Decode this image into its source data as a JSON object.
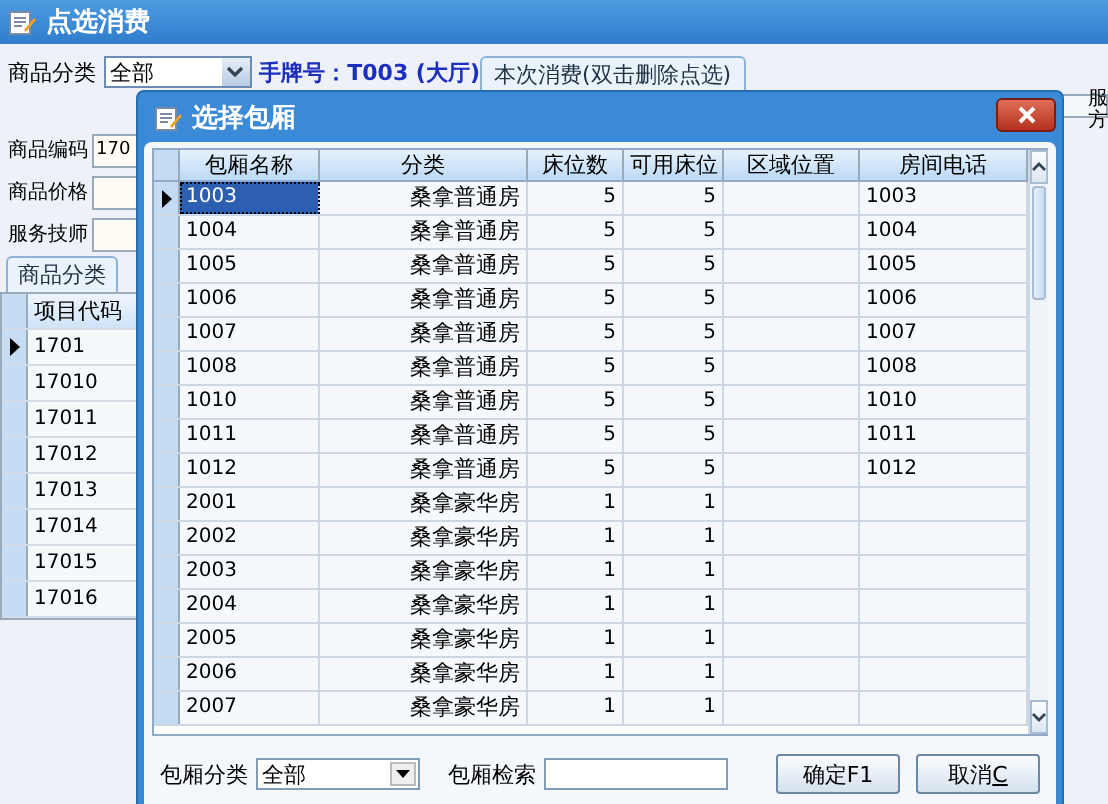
{
  "window": {
    "title": "点选消费"
  },
  "filters": {
    "category_label": "商品分类",
    "category_value": "全部",
    "tag_number": "手牌号：T003 (大厅)"
  },
  "consumption_tab": {
    "label": "本次消费(双击删除点选)",
    "selected": true
  },
  "consumption_grid_partial_header": [
    "服",
    "方"
  ],
  "fields": [
    {
      "label": "商品编码",
      "value": "170"
    },
    {
      "label": "商品价格"
    },
    {
      "label": "服务技师"
    }
  ],
  "item_tabs": [
    {
      "label": "商品分类",
      "selected": true
    }
  ],
  "items_table": {
    "columns": [
      "项目代码"
    ],
    "rows": [
      {
        "code": "1701",
        "selected": true
      },
      {
        "code": "17010",
        "selected": false
      },
      {
        "code": "17011",
        "selected": false
      },
      {
        "code": "17012",
        "selected": false
      },
      {
        "code": "17013",
        "selected": false
      },
      {
        "code": "17014",
        "selected": false
      },
      {
        "code": "17015",
        "selected": false
      },
      {
        "code": "17016",
        "selected": false
      }
    ]
  },
  "dialog": {
    "title": "选择包厢",
    "columns": [
      "包厢名称",
      "分类",
      "床位数",
      "可用床位",
      "区域位置",
      "房间电话"
    ],
    "rows": [
      {
        "cells": [
          "1003",
          "桑拿普通房",
          "5",
          "5",
          "",
          "1003"
        ],
        "selected": true
      },
      {
        "cells": [
          "1004",
          "桑拿普通房",
          "5",
          "5",
          "",
          "1004"
        ],
        "selected": false
      },
      {
        "cells": [
          "1005",
          "桑拿普通房",
          "5",
          "5",
          "",
          "1005"
        ],
        "selected": false
      },
      {
        "cells": [
          "1006",
          "桑拿普通房",
          "5",
          "5",
          "",
          "1006"
        ],
        "selected": false
      },
      {
        "cells": [
          "1007",
          "桑拿普通房",
          "5",
          "5",
          "",
          "1007"
        ],
        "selected": false
      },
      {
        "cells": [
          "1008",
          "桑拿普通房",
          "5",
          "5",
          "",
          "1008"
        ],
        "selected": false
      },
      {
        "cells": [
          "1010",
          "桑拿普通房",
          "5",
          "5",
          "",
          "1010"
        ],
        "selected": false
      },
      {
        "cells": [
          "1011",
          "桑拿普通房",
          "5",
          "5",
          "",
          "1011"
        ],
        "selected": false
      },
      {
        "cells": [
          "1012",
          "桑拿普通房",
          "5",
          "5",
          "",
          "1012"
        ],
        "selected": false
      },
      {
        "cells": [
          "2001",
          "桑拿豪华房",
          "1",
          "1",
          "",
          ""
        ],
        "selected": false
      },
      {
        "cells": [
          "2002",
          "桑拿豪华房",
          "1",
          "1",
          "",
          ""
        ],
        "selected": false
      },
      {
        "cells": [
          "2003",
          "桑拿豪华房",
          "1",
          "1",
          "",
          ""
        ],
        "selected": false
      },
      {
        "cells": [
          "2004",
          "桑拿豪华房",
          "1",
          "1",
          "",
          ""
        ],
        "selected": false
      },
      {
        "cells": [
          "2005",
          "桑拿豪华房",
          "1",
          "1",
          "",
          ""
        ],
        "selected": false
      },
      {
        "cells": [
          "2006",
          "桑拿豪华房",
          "1",
          "1",
          "",
          ""
        ],
        "selected": false
      },
      {
        "cells": [
          "2007",
          "桑拿豪华房",
          "1",
          "1",
          "",
          ""
        ],
        "selected": false
      }
    ],
    "room_type_label": "包厢分类",
    "room_type_value": "全部",
    "search_label": "包厢检索",
    "buttons": [
      {
        "label": "确定F1"
      },
      {
        "label": "取消",
        "accelerator": "C"
      }
    ]
  }
}
